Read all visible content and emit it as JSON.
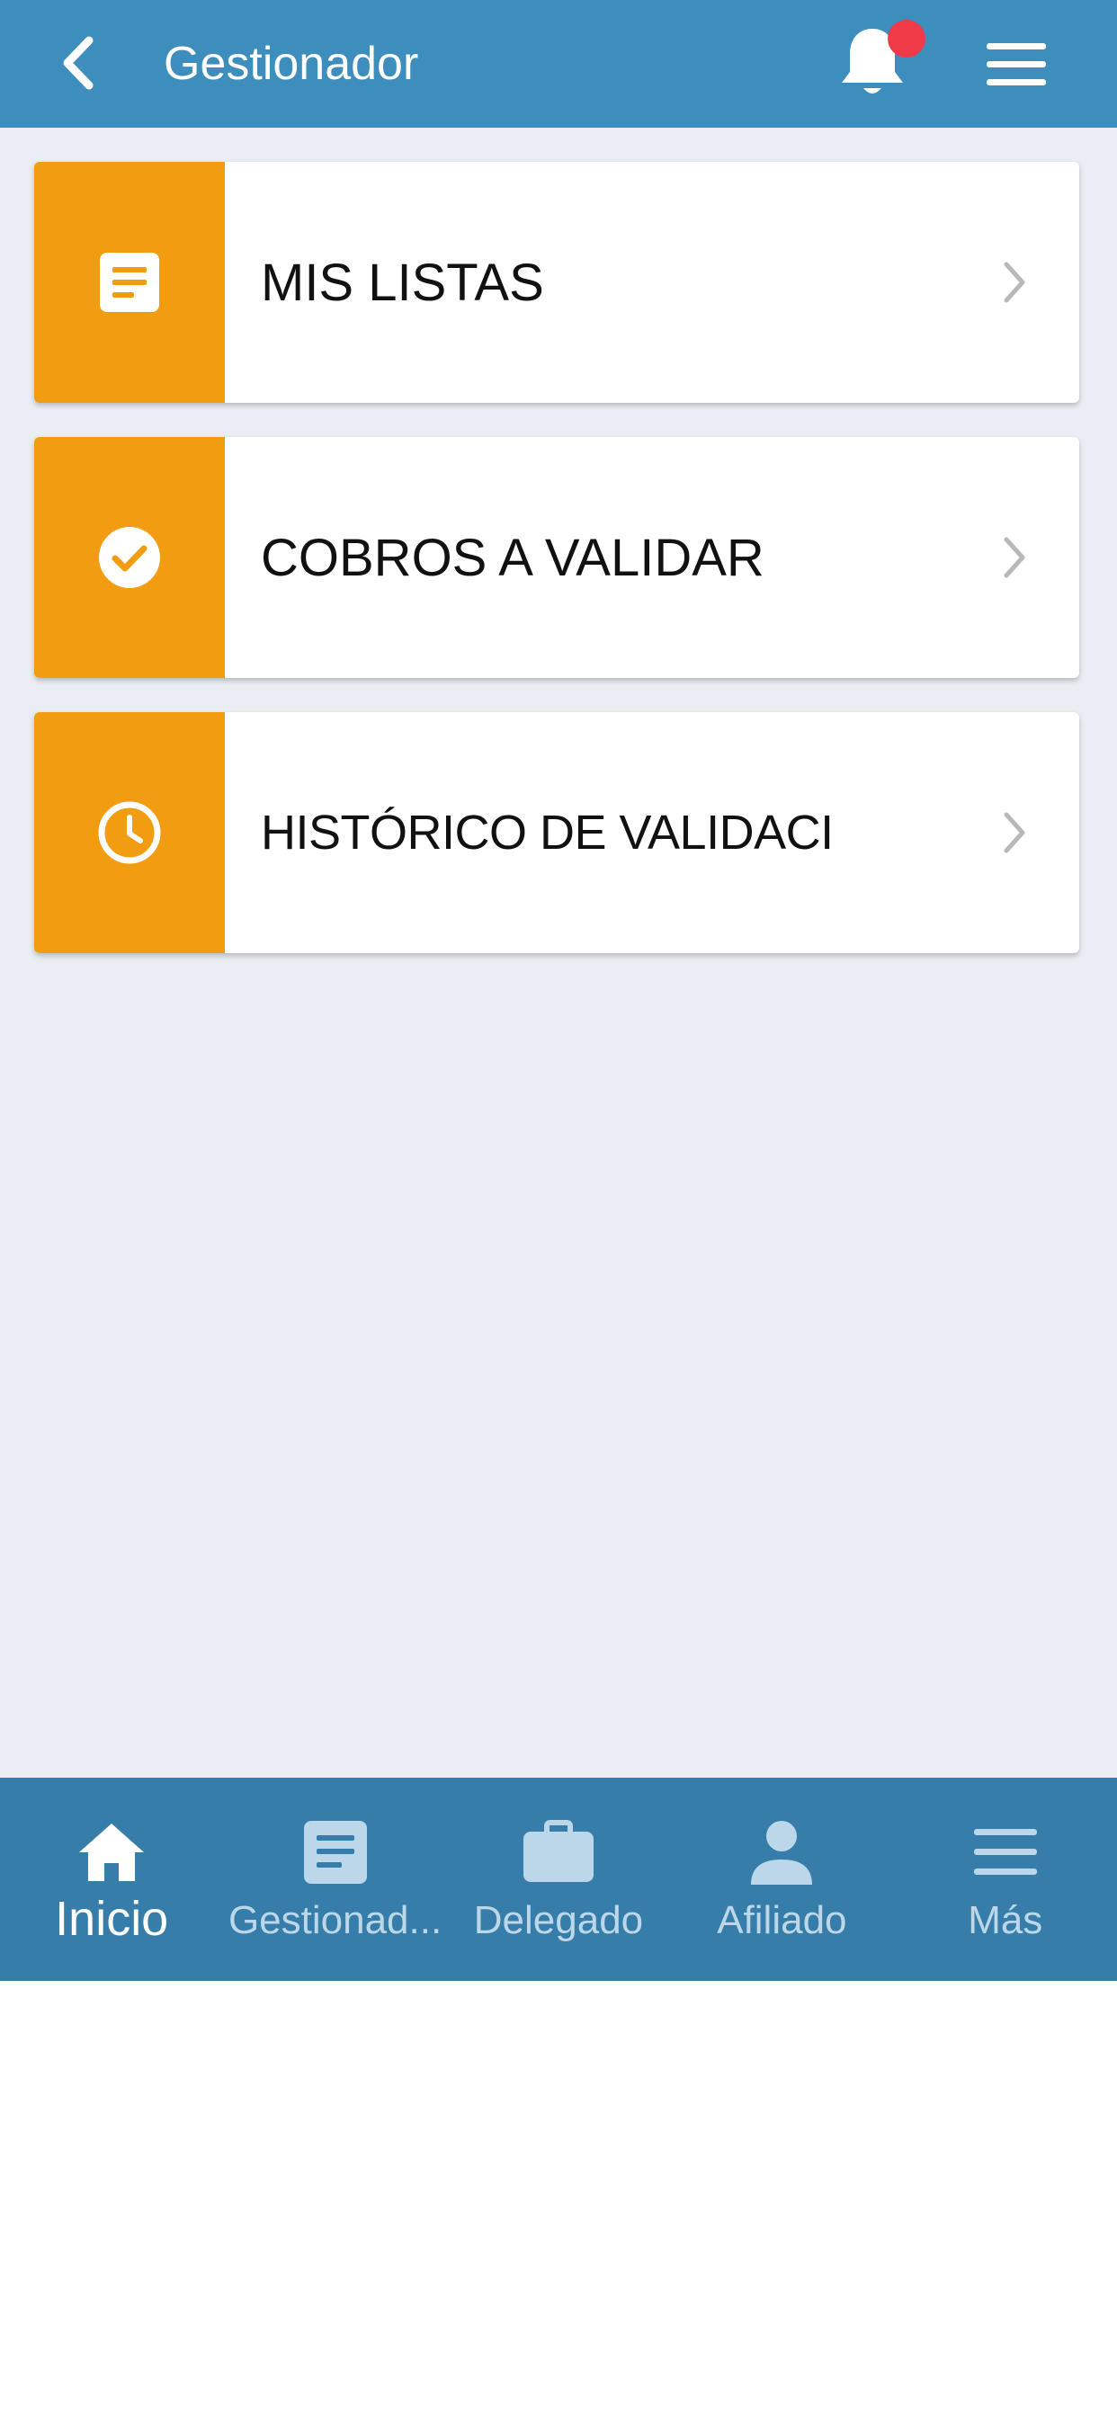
{
  "header": {
    "title": "Gestionador",
    "back_icon": "chevron-left-icon",
    "bell_icon": "bell-icon",
    "menu_icon": "hamburger-menu-icon"
  },
  "cards": [
    {
      "label": "MIS LISTAS",
      "icon": "document-icon"
    },
    {
      "label": "COBROS A VALIDAR",
      "icon": "check-circle-icon"
    },
    {
      "label": "HISTÓRICO DE VALIDACI",
      "icon": "clock-icon"
    }
  ],
  "bottom_nav": {
    "items": [
      {
        "label": "Inicio",
        "icon": "home-icon",
        "active": true
      },
      {
        "label": "Gestionad...",
        "icon": "document-icon",
        "active": false
      },
      {
        "label": "Delegado",
        "icon": "briefcase-icon",
        "active": false
      },
      {
        "label": "Afiliado",
        "icon": "person-icon",
        "active": false
      },
      {
        "label": "Más",
        "icon": "hamburger-menu-icon",
        "active": false
      }
    ]
  },
  "colors": {
    "header_bg": "#3d8dbd",
    "nav_bg": "#367ea9",
    "accent_orange": "#f29c12",
    "badge_red": "#f03a47",
    "page_bg": "#eaedf3"
  }
}
